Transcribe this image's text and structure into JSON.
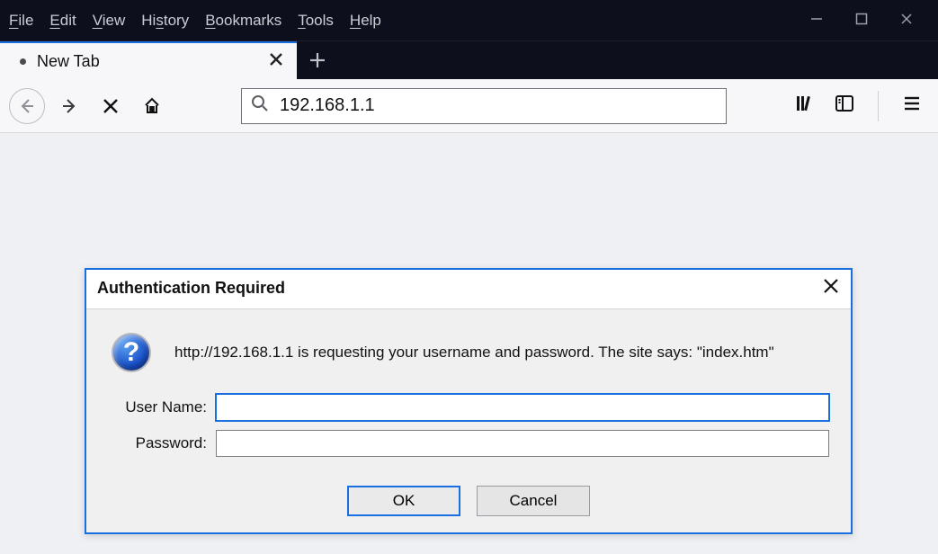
{
  "menu": {
    "file": "File",
    "edit": "Edit",
    "view": "View",
    "history": "History",
    "bookmarks": "Bookmarks",
    "tools": "Tools",
    "help": "Help"
  },
  "tab": {
    "title": "New Tab"
  },
  "address_bar": {
    "value": "192.168.1.1"
  },
  "auth_dialog": {
    "title": "Authentication Required",
    "message": "http://192.168.1.1 is requesting your username and password. The site says: \"index.htm\"",
    "username_label": "User Name:",
    "password_label": "Password:",
    "username_value": "",
    "password_value": "",
    "ok_label": "OK",
    "cancel_label": "Cancel"
  }
}
